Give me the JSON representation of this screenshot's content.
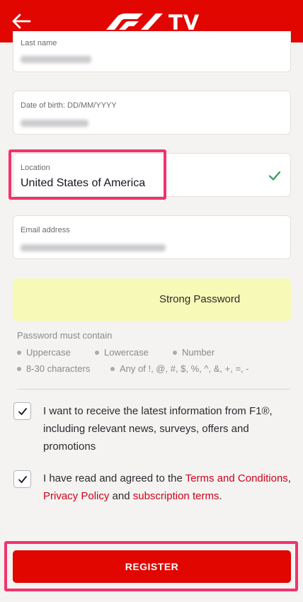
{
  "header": {
    "logo_text": "TV",
    "back_icon": "arrow-left-icon",
    "logo_icon": "f1-logo-icon",
    "background": "#e10600"
  },
  "form": {
    "last_name": {
      "label": "Last name"
    },
    "dob": {
      "label": "Date of birth: DD/MM/YYYY"
    },
    "location": {
      "label": "Location",
      "value": "United States of America",
      "valid_icon": "check-icon"
    },
    "email": {
      "label": "Email address"
    }
  },
  "password": {
    "strength": "Strong Password",
    "rules_title": "Password must contain",
    "rules": [
      "Uppercase",
      "Lowercase",
      "Number",
      "8-30 characters",
      "Any of !, @, #, $, %, ^, &, +, =, -"
    ]
  },
  "consent": {
    "marketing": {
      "checked": true,
      "text": "I want to receive the latest information from F1®, including relevant news, surveys, offers and promotions"
    },
    "terms": {
      "checked": true,
      "prefix": "I have read and agreed to the ",
      "terms_link": "Terms and Conditions",
      "sep": ", ",
      "privacy_link": "Privacy Policy",
      "and": " and ",
      "subscription_link": "subscription terms",
      "suffix": "."
    }
  },
  "register_label": "REGISTER",
  "colors": {
    "brand": "#e10600",
    "highlight": "#f2336b",
    "link": "#d0021b",
    "valid": "#2e9e59"
  }
}
